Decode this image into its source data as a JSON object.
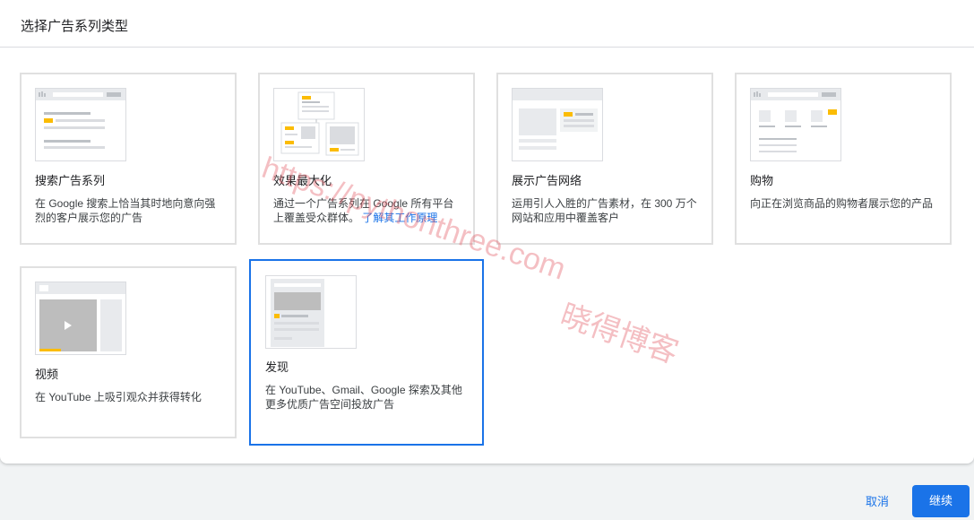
{
  "dialog": {
    "title": "选择广告系列类型"
  },
  "cards": [
    {
      "name": "搜索广告系列",
      "desc": "在 Google 搜索上恰当其时地向意向强烈的客户展示您的广告"
    },
    {
      "name": "效果最大化",
      "desc": "通过一个广告系列在 Google 所有平台上覆盖受众群体。",
      "link": "了解其工作原理"
    },
    {
      "name": "展示广告网络",
      "desc": "运用引人入胜的广告素材，在 300 万个网站和应用中覆盖客户"
    },
    {
      "name": "购物",
      "desc": "向正在浏览商品的购物者展示您的产品"
    },
    {
      "name": "视频",
      "desc": "在 YouTube 上吸引观众并获得转化"
    },
    {
      "name": "发现",
      "desc": "在 YouTube、Gmail、Google 探索及其他更多优质广告空间投放广告",
      "selected": true
    }
  ],
  "watermark": {
    "line1": "https://pythonthree.com",
    "line2": "晓得博客"
  },
  "footer": {
    "cancel_label": "取消",
    "continue_label": "继续"
  },
  "colors": {
    "accent": "#1a73e8",
    "thumb_highlight": "#fbbc04",
    "thumb_gray": "#dadce0"
  }
}
